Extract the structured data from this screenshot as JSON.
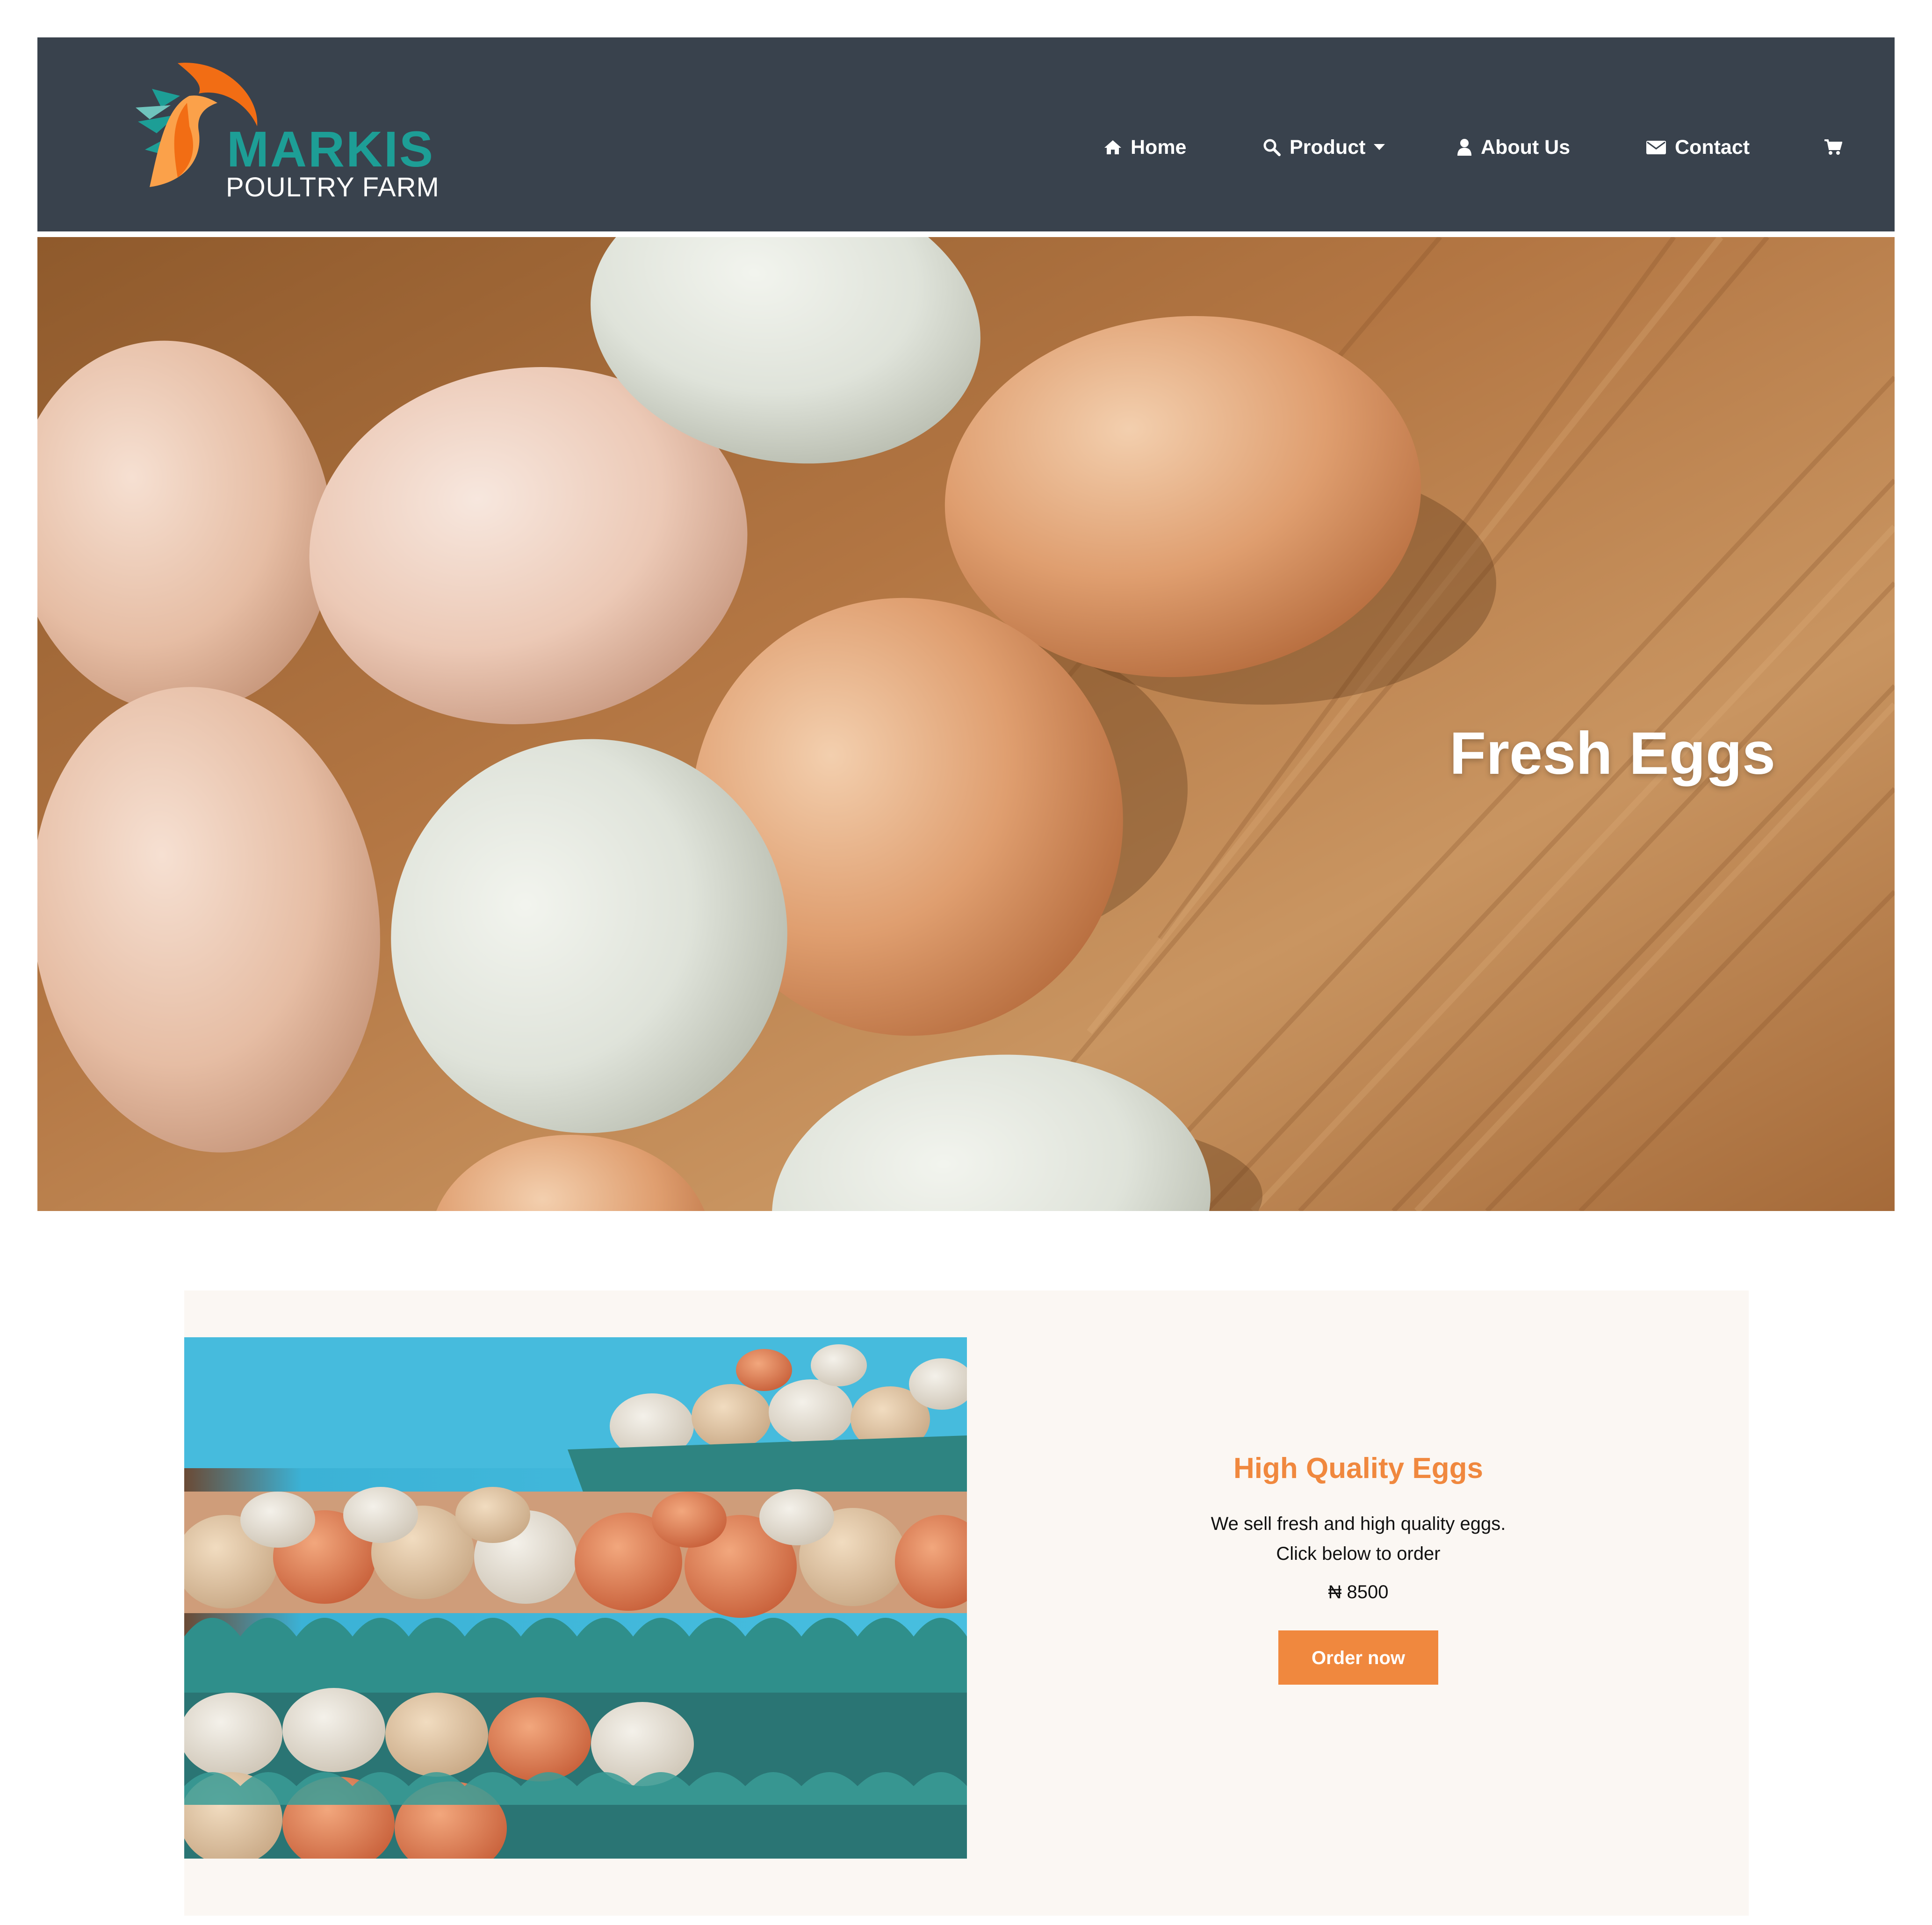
{
  "brand": {
    "name": "MARKIS",
    "tagline": "POULTRY FARM",
    "colors": {
      "teal": "#1d9e96",
      "orange": "#f26d14",
      "light_orange": "#fba14a",
      "header_bg": "#39424d",
      "accent": "#f0883e"
    }
  },
  "nav": {
    "items": [
      {
        "label": "Home",
        "icon": "home-icon"
      },
      {
        "label": "Product",
        "icon": "search-icon",
        "dropdown": true
      },
      {
        "label": "About Us",
        "icon": "user-icon"
      },
      {
        "label": "Contact",
        "icon": "envelope-icon"
      }
    ],
    "cart_icon": "cart-icon"
  },
  "hero": {
    "title": "Fresh Eggs"
  },
  "product": {
    "title": "High Quality Eggs",
    "description_line1": "We sell fresh and high quality eggs.",
    "description_line2": "Click below to order",
    "price": "₦ 8500",
    "order_button": "Order now"
  }
}
